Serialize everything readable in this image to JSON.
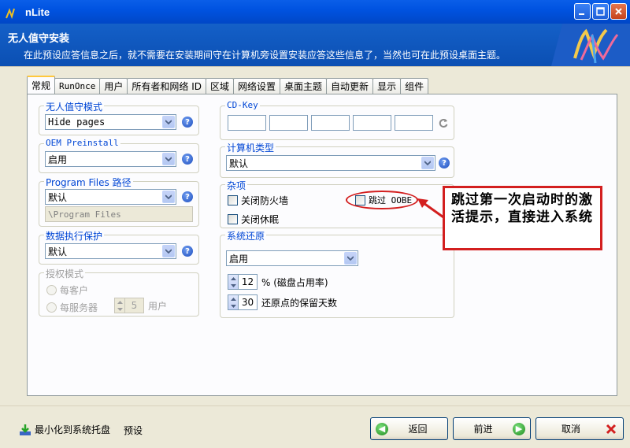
{
  "window": {
    "title": "nLite"
  },
  "header": {
    "title": "无人值守安装",
    "description": "在此预设应答信息之后，就不需要在安装期间守在计算机旁设置安装应答这些信息了，当然也可在此预设桌面主题。"
  },
  "tabs": [
    {
      "label": "常规",
      "active": true
    },
    {
      "label": "RunOnce"
    },
    {
      "label": "用户"
    },
    {
      "label": "所有者和网络 ID"
    },
    {
      "label": "区域"
    },
    {
      "label": "网络设置"
    },
    {
      "label": "桌面主题"
    },
    {
      "label": "自动更新"
    },
    {
      "label": "显示"
    },
    {
      "label": "组件"
    }
  ],
  "left": {
    "unattended": {
      "legend": "无人值守模式",
      "value": "Hide pages"
    },
    "oem": {
      "legend": "OEM Preinstall",
      "value": "启用"
    },
    "program_files": {
      "legend": "Program Files 路径",
      "value": "默认",
      "path": "\\Program Files"
    },
    "dep": {
      "legend": "数据执行保护",
      "value": "默认"
    },
    "license": {
      "legend": "授权模式",
      "per_seat": "每客户",
      "per_server": "每服务器",
      "users_value": "5",
      "users_label": "用户"
    }
  },
  "right": {
    "cdkey": {
      "legend": "CD-Key"
    },
    "computer_type": {
      "legend": "计算机类型",
      "value": "默认"
    },
    "misc": {
      "legend": "杂项",
      "firewall": "关闭防火墙",
      "hibernate": "关闭休眠",
      "skip_oobe": "跳过 OOBE"
    },
    "restore": {
      "legend": "系统还原",
      "value": "启用",
      "disk_value": "12",
      "disk_label": "% (磁盘占用率)",
      "days_value": "30",
      "days_label": "还原点的保留天数"
    }
  },
  "annotation": {
    "text": "跳过第一次启动时的激活提示，直接进入系统"
  },
  "footer": {
    "tray_label": "最小化到系统托盘",
    "preset_label": "预设",
    "back_label": "返回",
    "next_label": "前进",
    "cancel_label": "取消"
  },
  "colors": {
    "annotation_red": "#d31f1f",
    "header_blue": "#0b4fb3",
    "legend_blue": "#0046d5"
  }
}
